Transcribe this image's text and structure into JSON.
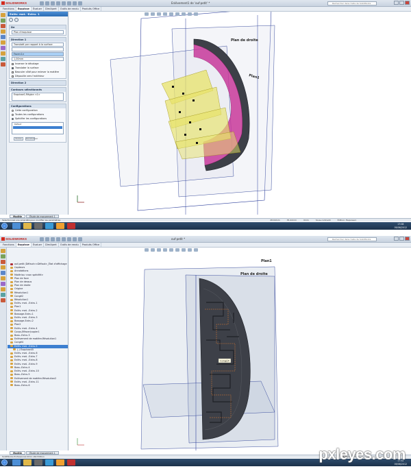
{
  "top": {
    "app_name": "SOLIDWORKS",
    "doc_title": "Enlèvement1 de 'ouf-petit' *",
    "search_placeholder": "Rechercher dans l'aide de SolidWorks",
    "tabs": [
      "Fonctions",
      "Esquisse",
      "Évaluer",
      "DimXpert",
      "Outils de rendu",
      "Produits Office"
    ],
    "active_tab": "Esquisse",
    "pm_title": "Enlèv. mat. -Extru. 1",
    "group_de": "De",
    "de_value": "Plan d'esquisse",
    "group_dir1": "Direction 1",
    "dir1_type": "Translaté par rapport à la surface",
    "dir1_face": "Face<1>",
    "dir1_depth": "1,00mm",
    "opt_inverse": "Inverser le décalage",
    "opt_translate": "Translater la surface",
    "opt_flip": "Basculer côté pour enlever la matière",
    "opt_draft": "Dépouille vers l'extérieur",
    "group_dir2": "Direction 2",
    "group_contours": "Contours sélectionnés",
    "contour_item": "Esquisse1-Région <1>",
    "group_config": "Configurations",
    "cfg_this": "Cette configuration",
    "cfg_all": "Toutes les configurations",
    "cfg_specify": "Spécifier les configurations",
    "cfg_list": [
      "Défaut"
    ],
    "cfg_btn_all": "Toutes",
    "cfg_btn_reset": "Réinitialiser",
    "plane_right": "Plan de droite",
    "plane1": "Plan1",
    "model_tabs": [
      "Modèle",
      "Étude de mouvement 1"
    ],
    "status_left": "Sélectionnez une propriété pour modifier les paramètres",
    "status_vals": [
      "28.64mm",
      "35.22mm",
      "0mm",
      "Sous-contraint",
      "Édition: Esquisse1"
    ],
    "clock": [
      "17:08",
      "09/06/2012"
    ]
  },
  "bottom": {
    "app_name": "SOLIDWORKS",
    "doc_title": "ouf-petit *",
    "search_placeholder": "Rechercher dans l'aide de SolidWorks",
    "tabs": [
      "Fonctions",
      "Esquisse",
      "Évaluer",
      "DimXpert",
      "Outils de rendu",
      "Produits Office"
    ],
    "active_tab": "Esquisse",
    "tree": [
      {
        "label": "ouf-petit (Défaut<<Défaut>_État d'affichage",
        "root": true
      },
      {
        "label": "Capteurs"
      },
      {
        "label": "Annotations"
      },
      {
        "label": "Matériau <non spécifié>"
      },
      {
        "label": "Plan de face"
      },
      {
        "label": "Plan de dessus"
      },
      {
        "label": "Plan de droite"
      },
      {
        "label": "Origine"
      },
      {
        "label": "Révolution1"
      },
      {
        "label": "Congé2"
      },
      {
        "label": "Révolution1"
      },
      {
        "label": "Enlèv. mat. -Extru.1"
      },
      {
        "label": "Plan1"
      },
      {
        "label": "Enlèv. mat. -Extru.2"
      },
      {
        "label": "Bossage-Extru.1"
      },
      {
        "label": "Enlèv. mat. -Extru.3"
      },
      {
        "label": "Bossage-Extru.2"
      },
      {
        "label": "Plan2"
      },
      {
        "label": "Enlèv. mat. -Extru.4"
      },
      {
        "label": "Corps-Effacer/copier1"
      },
      {
        "label": "Boss.-Extru.3"
      },
      {
        "label": "Enlèvement de matière-Révolution1"
      },
      {
        "label": "Congé4"
      },
      {
        "label": "Enlèv. mat. -Extru.5",
        "selected": true
      },
      {
        "label": "(-) Esquisse45",
        "indent": true
      },
      {
        "label": "Enlèv. mat. -Extru.6"
      },
      {
        "label": "Enlèv. mat. -Extru.7"
      },
      {
        "label": "Enlèv. mat. -Extru.8"
      },
      {
        "label": "Enlèv. mat. -Extru.9"
      },
      {
        "label": "Boss.-Extru.4"
      },
      {
        "label": "Enlèv. mat. -Extru.10"
      },
      {
        "label": "Boss.-Extru.5"
      },
      {
        "label": "Enlèvement de matière-Révolution2"
      },
      {
        "label": "Enlèv. mat. -Extru.11"
      },
      {
        "label": "Boss.-Extru.6"
      }
    ],
    "callout": "Congé4",
    "plane_right": "Plan de droite",
    "plane1": "Plan1",
    "model_tabs": [
      "Modèle",
      "Étude de mouvement 1"
    ],
    "status_left": "SolidWorks Professional 2011 x64 Edition",
    "status_vals": [
      "Édition Pièce"
    ],
    "clock": [
      "17:32",
      "09/06/2012"
    ]
  },
  "watermark": "pxleyes.com",
  "colors": {
    "accent": "#2b6cb3",
    "model_grey": "#3d4048",
    "highlight_yellow": "#e8e36a",
    "magenta": "#c8389a",
    "plane_blue": "#2c3f9c"
  }
}
